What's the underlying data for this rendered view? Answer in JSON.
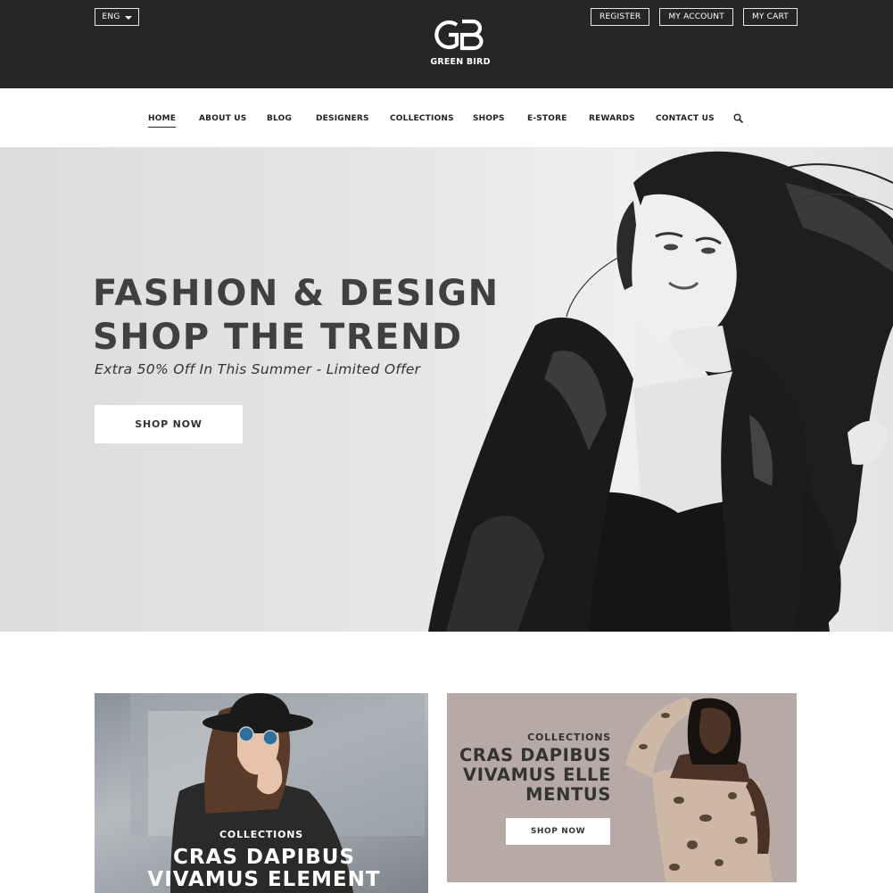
{
  "header": {
    "language": "ENG",
    "logo_text": "GREEN BIRD",
    "links": [
      "REGISTER",
      "MY ACCOUNT",
      "MY CART"
    ]
  },
  "nav": {
    "items": [
      "HOME",
      "ABOUT US",
      "BLOG",
      "DESIGNERS",
      "COLLECTIONS",
      "SHOPS",
      "E-STORE",
      "REWARDS",
      "CONTACT US"
    ],
    "active": "HOME",
    "search_icon": "search-icon"
  },
  "hero": {
    "title_line1": "FASHION & DESIGN",
    "title_line2": "SHOP THE TREND",
    "subtitle": "Extra 50% Off In This Summer - Limited Offer",
    "button": "SHOP NOW"
  },
  "cards": [
    {
      "label": "COLLECTIONS",
      "title_line1": "CRAS DAPIBUS",
      "title_line2": "VIVAMUS ELEMENT"
    },
    {
      "label": "COLLECTIONS",
      "title_line1": "CRAS DAPIBUS",
      "title_line2": "VIVAMUS ELLE",
      "title_line3": "MENTUS",
      "button": "SHOP NOW"
    }
  ],
  "colors": {
    "topbar": "#262626",
    "hero_text": "#404040",
    "right_card_bg": "#b6a9a6"
  }
}
